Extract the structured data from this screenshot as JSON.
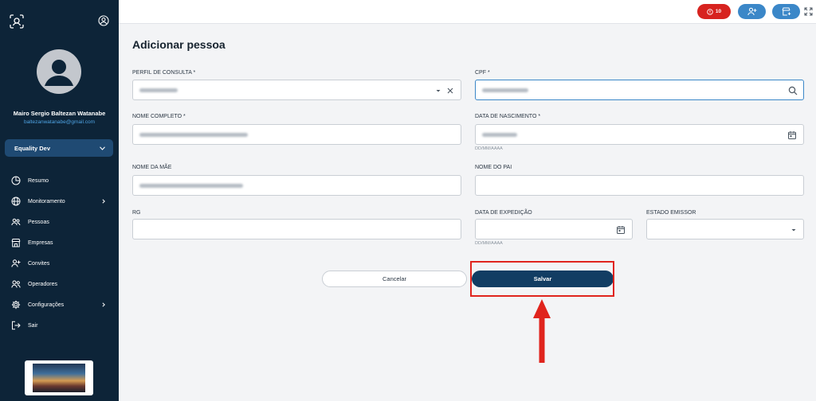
{
  "sidebar": {
    "user_name": "Mairo Sergio Baltezan Watanabe",
    "user_email": "baltezanwatanabe@gmail.com",
    "workspace": "Equality Dev",
    "items": [
      {
        "label": "Resumo",
        "icon": "pie-chart-icon"
      },
      {
        "label": "Monitoramento",
        "icon": "globe-icon"
      },
      {
        "label": "Pessoas",
        "icon": "people-icon"
      },
      {
        "label": "Empresas",
        "icon": "store-icon"
      },
      {
        "label": "Convites",
        "icon": "add-user-icon"
      },
      {
        "label": "Operadores",
        "icon": "operators-icon"
      },
      {
        "label": "Configurações",
        "icon": "gear-icon"
      },
      {
        "label": "Sair",
        "icon": "logout-icon"
      }
    ]
  },
  "topbar": {
    "alert_count": "10",
    "colors": {
      "alert": "#d7231f",
      "action": "#3b87c8"
    }
  },
  "page": {
    "title": "Adicionar pessoa"
  },
  "form": {
    "perfil_label": "PERFIL DE CONSULTA *",
    "cpf_label": "CPF *",
    "nome_label": "NOME COMPLETO *",
    "nascimento_label": "DATA DE NASCIMENTO *",
    "nascimento_hint": "DD/MM/AAAA",
    "mae_label": "NOME DA MÃE",
    "pai_label": "NOME DO PAI",
    "rg_label": "RG",
    "expedicao_label": "DATA DE EXPEDIÇÃO",
    "expedicao_hint": "DD/MM/AAAA",
    "estado_label": "ESTADO EMISSOR"
  },
  "actions": {
    "cancel_label": "Cancelar",
    "save_label": "Salvar"
  }
}
